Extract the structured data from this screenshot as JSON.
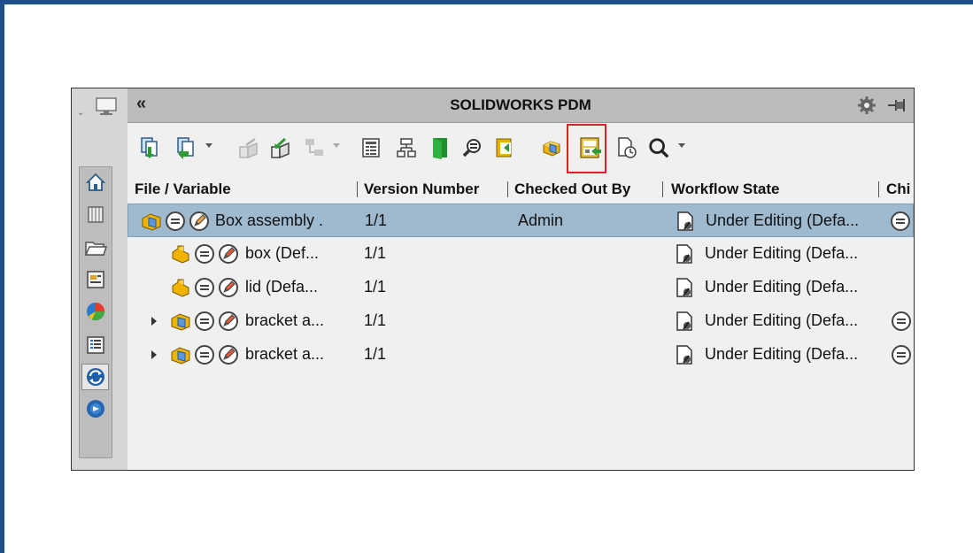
{
  "app": {
    "title": "SOLIDWORKS PDM",
    "collapse_glyph": "«"
  },
  "toolbar": {
    "buttons": [
      {
        "icon": "get-latest-icon",
        "enabled": true
      },
      {
        "icon": "get-version-icon",
        "enabled": true,
        "dropdown": true
      },
      {
        "icon": "check-in-icon",
        "enabled": false
      },
      {
        "icon": "check-out-icon",
        "enabled": true
      },
      {
        "icon": "change-state-icon",
        "enabled": false,
        "dropdown": true
      },
      {
        "icon": "data-card-icon",
        "enabled": true
      },
      {
        "icon": "contains-icon",
        "enabled": true
      },
      {
        "icon": "open-folder-icon",
        "enabled": true
      },
      {
        "icon": "where-used-icon",
        "enabled": true
      },
      {
        "icon": "bom-icon",
        "enabled": true
      },
      {
        "icon": "assembly-icon",
        "enabled": true
      },
      {
        "icon": "workflow-transition-icon",
        "enabled": true,
        "highlighted": true
      },
      {
        "icon": "history-icon",
        "enabled": true
      },
      {
        "icon": "search-icon",
        "enabled": true,
        "dropdown": true
      }
    ]
  },
  "columns": {
    "file": "File / Variable",
    "version": "Version Number",
    "checked_out": "Checked Out By",
    "workflow": "Workflow State",
    "children": "Chi"
  },
  "rows": [
    {
      "name": "Box assembly .",
      "version": "1/1",
      "checked_out": "Admin",
      "state": "Under Editing (Defa...",
      "type": "assembly",
      "selected": true,
      "expandable": false,
      "indent": 0,
      "child_icon": true
    },
    {
      "name": "box  (Def...",
      "version": "1/1",
      "checked_out": "",
      "state": "Under Editing (Defa...",
      "type": "part",
      "selected": false,
      "expandable": false,
      "indent": 1,
      "child_icon": false
    },
    {
      "name": "lid  (Defa...",
      "version": "1/1",
      "checked_out": "",
      "state": "Under Editing (Defa...",
      "type": "part",
      "selected": false,
      "expandable": false,
      "indent": 1,
      "child_icon": false
    },
    {
      "name": "bracket a...",
      "version": "1/1",
      "checked_out": "",
      "state": "Under Editing (Defa...",
      "type": "assembly",
      "selected": false,
      "expandable": true,
      "indent": 1,
      "child_icon": true
    },
    {
      "name": "bracket a...",
      "version": "1/1",
      "checked_out": "",
      "state": "Under Editing (Defa...",
      "type": "assembly",
      "selected": false,
      "expandable": true,
      "indent": 1,
      "child_icon": true
    }
  ],
  "sidebar": {
    "items": [
      {
        "icon": "home-icon"
      },
      {
        "icon": "vault-icon"
      },
      {
        "icon": "folder-icon"
      },
      {
        "icon": "browser-icon"
      },
      {
        "icon": "pie-chart-icon"
      },
      {
        "icon": "list-view-icon"
      },
      {
        "icon": "pdm-sync-icon",
        "selected": true
      },
      {
        "icon": "globe-icon"
      }
    ]
  },
  "colors": {
    "accent_border": "#1f4e8c",
    "selection": "#9fb9cf",
    "highlight": "#e02020"
  }
}
